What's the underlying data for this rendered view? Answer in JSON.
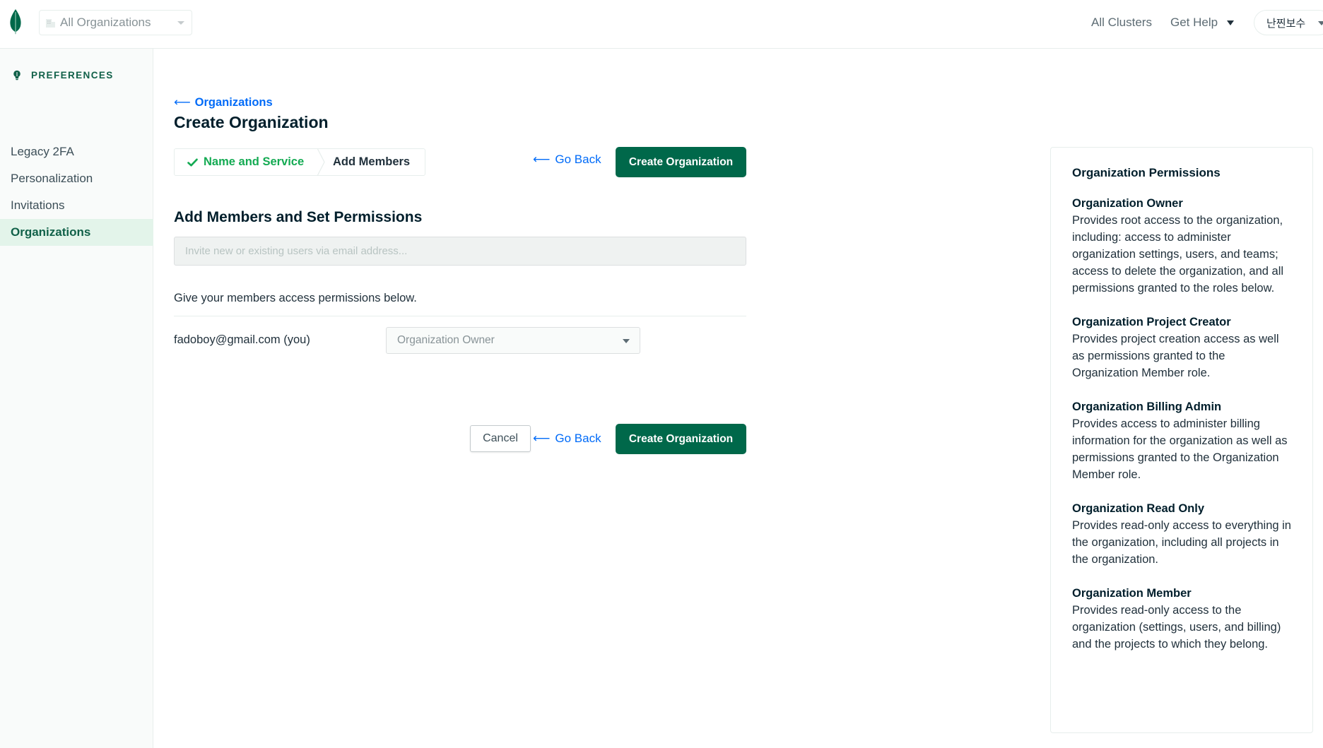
{
  "topbar": {
    "org_select": "All Organizations",
    "links": {
      "all_clusters": "All Clusters",
      "get_help": "Get Help"
    },
    "user": "난찐보수"
  },
  "sidebar": {
    "heading": "PREFERENCES",
    "items": [
      {
        "label": "Legacy 2FA",
        "active": false
      },
      {
        "label": "Personalization",
        "active": false
      },
      {
        "label": "Invitations",
        "active": false
      },
      {
        "label": "Organizations",
        "active": true
      }
    ]
  },
  "main": {
    "breadcrumb": "Organizations",
    "title": "Create Organization",
    "steps": [
      {
        "label": "Name and Service",
        "status": "complete"
      },
      {
        "label": "Add Members",
        "status": "current"
      }
    ],
    "go_back": "Go Back",
    "create_button": "Create Organization",
    "cancel_button": "Cancel",
    "section_title": "Add Members and Set Permissions",
    "invite_placeholder": "Invite new or existing users via email address...",
    "invite_value": "",
    "permissions_note": "Give your members access permissions below.",
    "members": [
      {
        "email": "fadoboy@gmail.com (you)",
        "role": "Organization Owner"
      }
    ]
  },
  "permissions_panel": {
    "title": "Organization Permissions",
    "roles": [
      {
        "name": "Organization Owner",
        "description": "Provides root access to the organization, including: access to administer organization settings, users, and teams; access to delete the organization, and all permissions granted to the roles below."
      },
      {
        "name": "Organization Project Creator",
        "description": "Provides project creation access as well as permissions granted to the Organization Member role."
      },
      {
        "name": "Organization Billing Admin",
        "description": "Provides access to administer billing information for the organization as well as permissions granted to the Organization Member role."
      },
      {
        "name": "Organization Read Only",
        "description": "Provides read-only access to everything in the organization, including all projects in the organization."
      },
      {
        "name": "Organization Member",
        "description": "Provides read-only access to the organization (settings, users, and billing) and the projects to which they belong."
      }
    ]
  },
  "colors": {
    "brand_green": "#00684a",
    "success_green": "#13aa52",
    "link_blue": "#016bf8",
    "active_nav_bg": "#e3f4ea"
  },
  "icons": {
    "logo": "mongodb-leaf-icon",
    "org": "building-icon",
    "back": "arrow-left-icon",
    "step_done": "checkmark-icon",
    "dropdown": "caret-down-icon"
  }
}
